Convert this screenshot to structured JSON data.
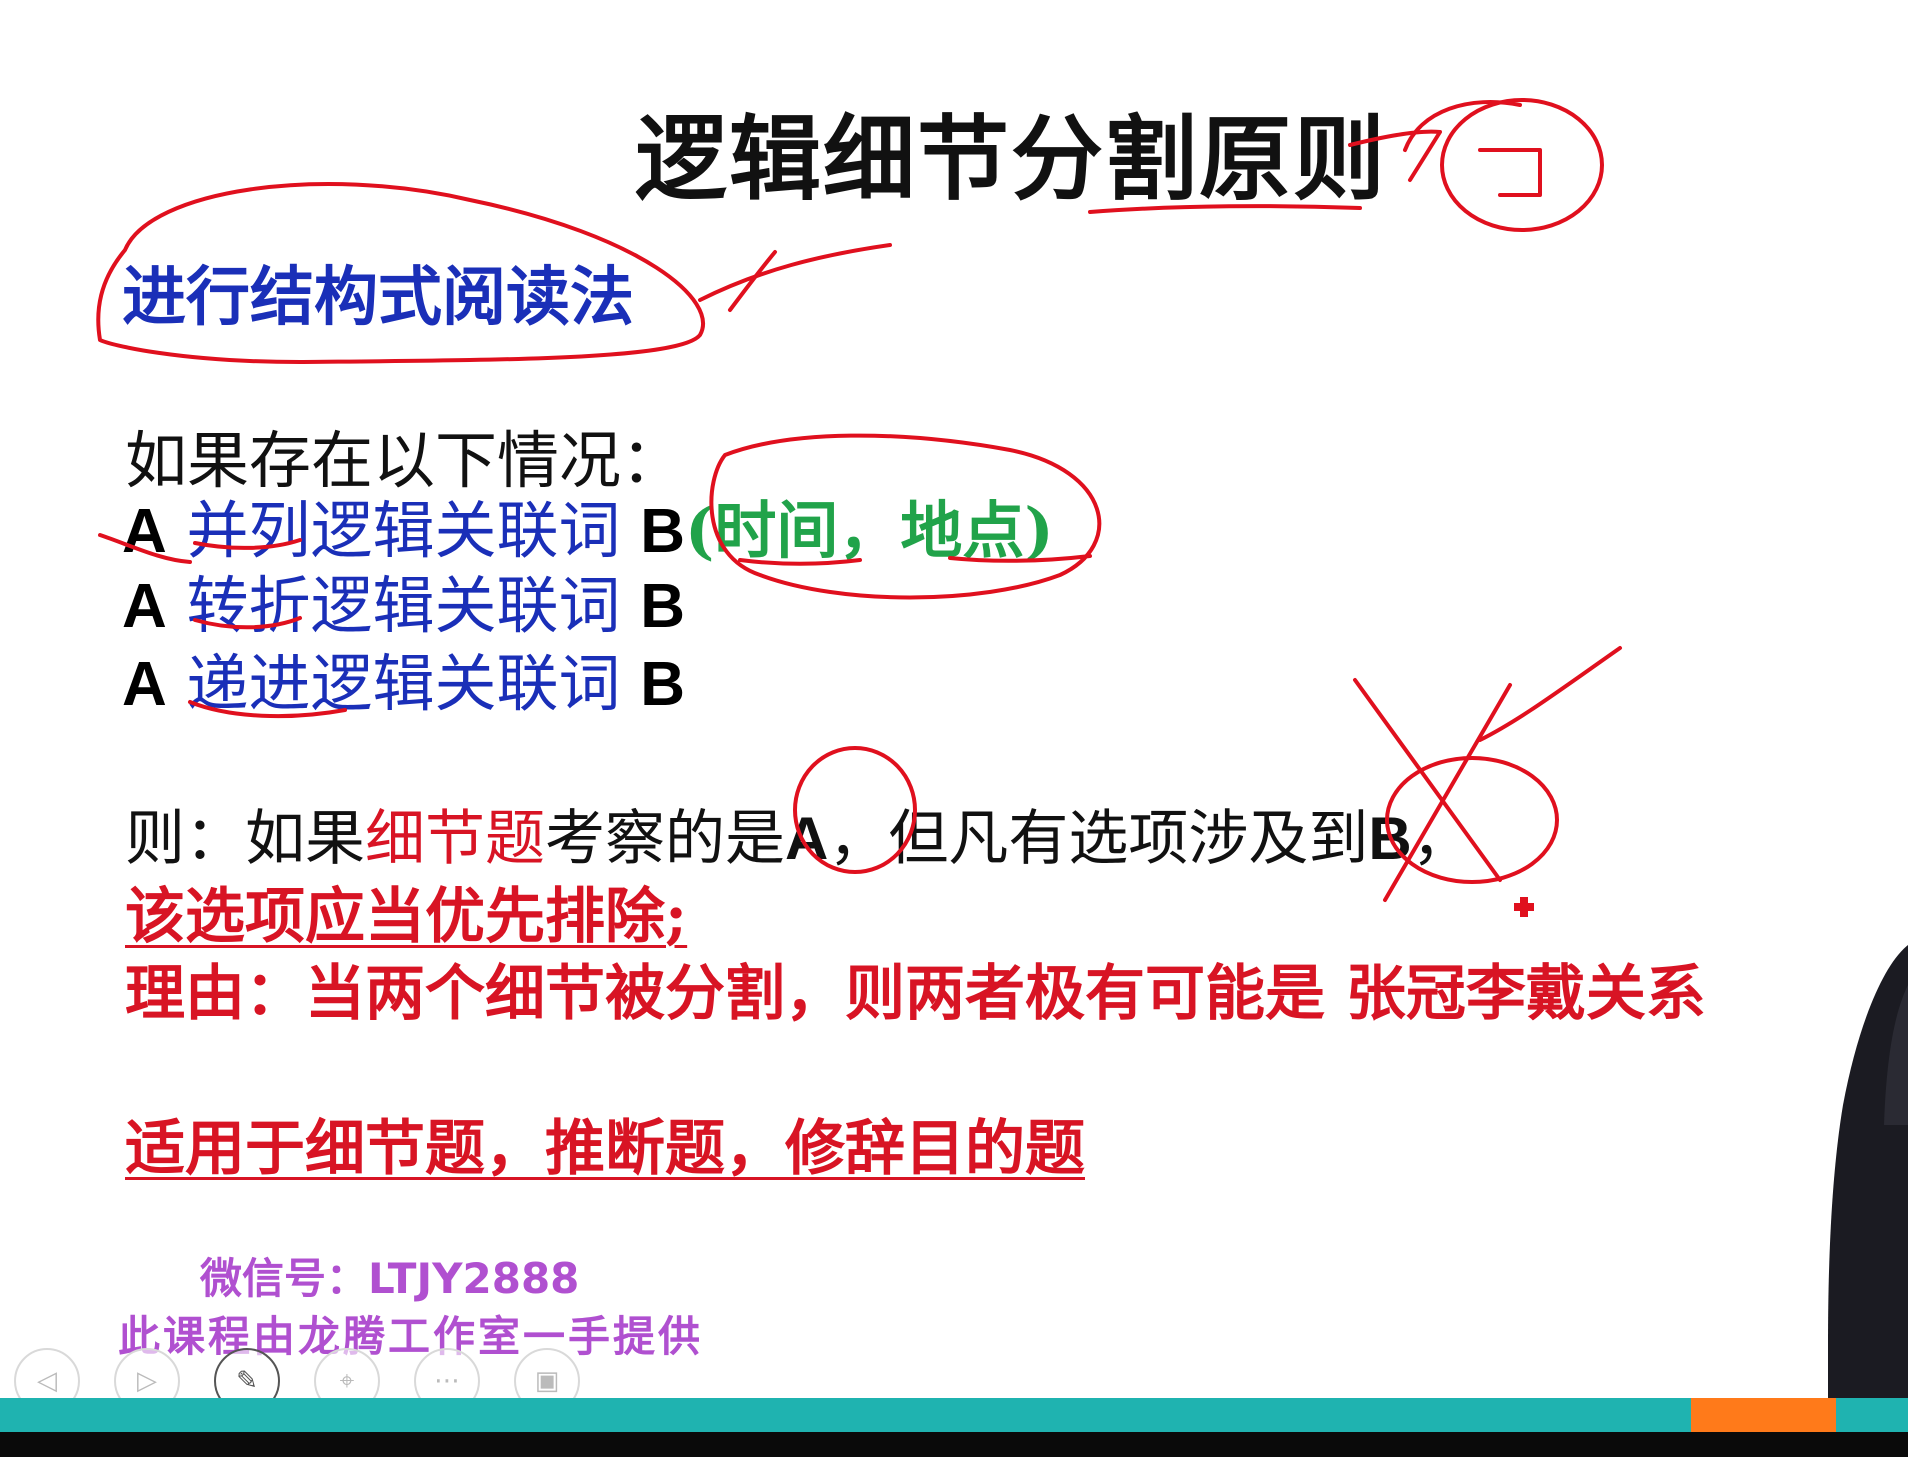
{
  "slide": {
    "title": "逻辑细节分割原则",
    "subtitle": "进行结构式阅读法",
    "intro": "如果存在以下情况：",
    "relations": [
      {
        "a": "A",
        "keyword": "并列逻辑关联词",
        "b": "B",
        "note": "(时间，地点)"
      },
      {
        "a": "A",
        "keyword": "转折逻辑关联词",
        "b": "B",
        "note": ""
      },
      {
        "a": "A",
        "keyword": "递进逻辑关联词",
        "b": "B",
        "note": ""
      }
    ],
    "rule": {
      "prefix": "则：如果",
      "highlight": "细节题",
      "middle": "考察的是",
      "a": "A",
      "middle2": "，但凡有选项涉及到",
      "b": "B",
      "suffix": "，"
    },
    "conclusion": "该选项应当优先排除;",
    "reason": "理由：当两个细节被分割，则两者极有可能是 张冠李戴关系",
    "scope": "适用于细节题，推断题，修辞目的题",
    "wechat": "微信号：LTJY2888",
    "course": "此课程由龙腾工作室一手提供"
  },
  "toolbar": {
    "buttons": [
      {
        "icon": "previous-icon",
        "glyph": "◁"
      },
      {
        "icon": "next-icon",
        "glyph": "▷"
      },
      {
        "icon": "pen-icon",
        "glyph": "✎"
      },
      {
        "icon": "pointer-icon",
        "glyph": "⌖"
      },
      {
        "icon": "more-icon",
        "glyph": "⋯"
      },
      {
        "icon": "screen-icon",
        "glyph": "▣"
      }
    ]
  },
  "colors": {
    "title": "#111111",
    "subtitle_blue": "#1a2fb8",
    "keyword_blue": "#1a2fb8",
    "note_green": "#21a34a",
    "emphasis_red": "#d81424",
    "ink_red": "#e0101e",
    "watermark_purple": "#b050d0",
    "bar_teal": "#1fb3b0",
    "bar_orange": "#ff7a1a"
  }
}
